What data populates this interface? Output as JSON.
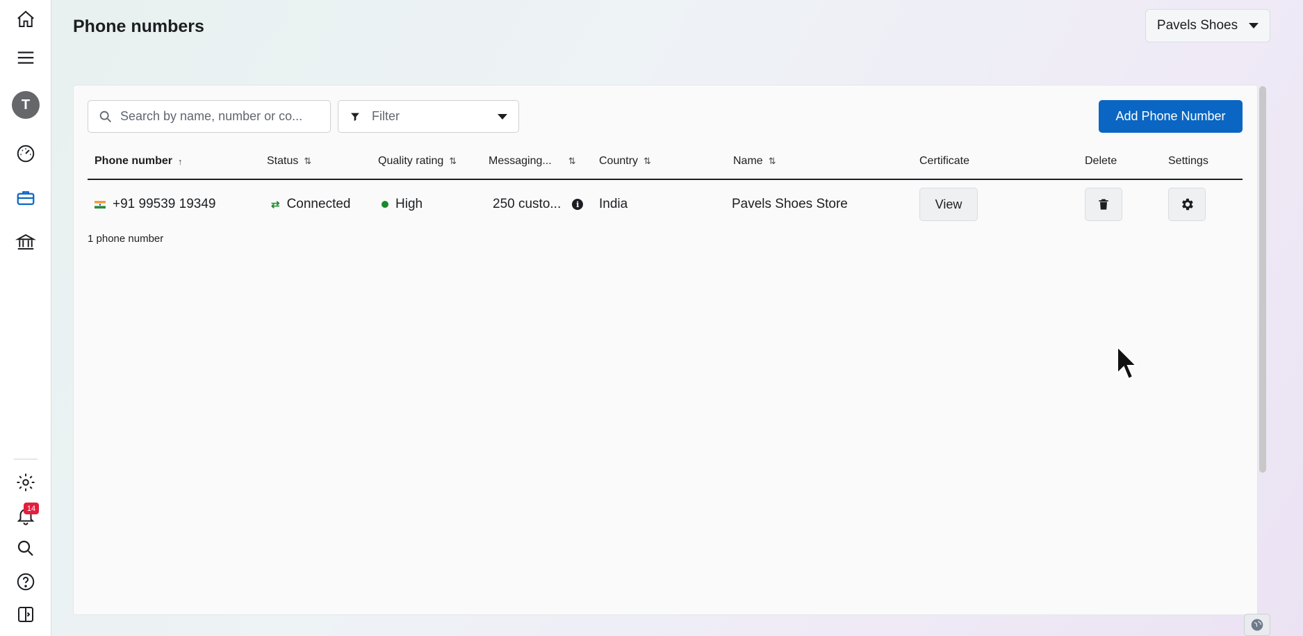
{
  "header": {
    "title": "Phone numbers",
    "account": "Pavels Shoes"
  },
  "sidebar": {
    "avatar_letter": "T",
    "notification_count": "14"
  },
  "toolbar": {
    "search_placeholder": "Search by name, number or co...",
    "filter_label": "Filter",
    "add_button": "Add Phone Number"
  },
  "table": {
    "columns": [
      "Phone number",
      "Status",
      "Quality rating",
      "Messaging...",
      "Country",
      "Name",
      "Certificate",
      "Delete",
      "Settings"
    ],
    "rows": [
      {
        "phone": "+91 99539 19349",
        "status": "Connected",
        "quality": "High",
        "messaging": "250 custo...",
        "country": "India",
        "name": "Pavels Shoes Store",
        "certificate": "View"
      }
    ],
    "count_label": "1 phone number"
  },
  "colors": {
    "accent": "#0a66c2",
    "status_green": "#1a8a2c",
    "badge_red": "#e41e3f"
  }
}
